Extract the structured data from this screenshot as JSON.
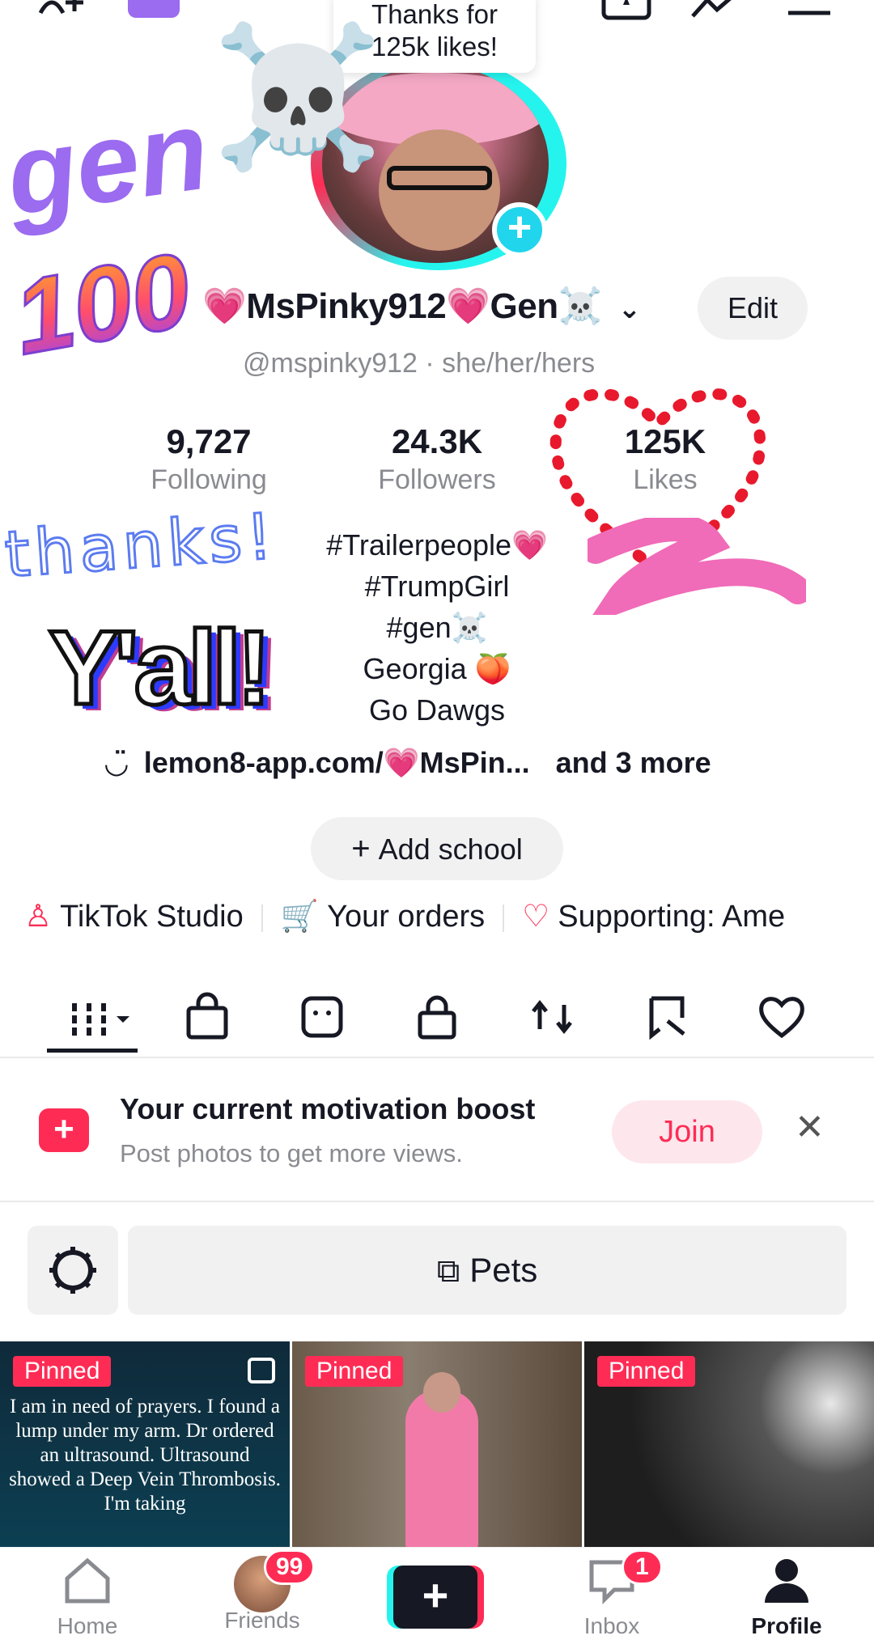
{
  "colors": {
    "accent": "#fe2c55",
    "teal": "#25f4ee",
    "sticker_purple": "#9b6bf0"
  },
  "tooltip": {
    "line1": "Thanks for",
    "line2": "125k likes!"
  },
  "profile": {
    "display_name": "💗MsPinky912💗Gen☠️",
    "edit_label": "Edit",
    "handle": "@mspinky912 · she/her/hers"
  },
  "stats": [
    {
      "value": "9,727",
      "label": "Following"
    },
    {
      "value": "24.3K",
      "label": "Followers"
    },
    {
      "value": "125K",
      "label": "Likes"
    }
  ],
  "bio": [
    "#Trailerpeople💗",
    "#TrumpGirl",
    "#gen☠️",
    "Georgia 🍑",
    "Go Dawgs"
  ],
  "link": {
    "text": "lemon8-app.com/💗MsPin...",
    "more": "and 3 more"
  },
  "add_school": "Add school",
  "tools": [
    {
      "label": "TikTok Studio",
      "icon": "person-star-icon"
    },
    {
      "label": "Your orders",
      "icon": "cart-icon"
    },
    {
      "label": "Supporting: Ame",
      "icon": "heart-hand-icon"
    }
  ],
  "boost": {
    "title": "Your current motivation boost",
    "subtitle": "Post photos to get more views.",
    "join_label": "Join"
  },
  "filter": {
    "label": "Pets"
  },
  "videos": [
    {
      "badge": "Pinned",
      "text": "I am in need of prayers. I found a lump under my arm. Dr ordered an ultrasound. Ultrasound showed a Deep Vein Thrombosis. I'm taking"
    },
    {
      "badge": "Pinned",
      "text": ""
    },
    {
      "badge": "Pinned",
      "text": ""
    }
  ],
  "nav": {
    "home": "Home",
    "friends": "Friends",
    "friends_badge": "99",
    "inbox": "Inbox",
    "inbox_badge": "1",
    "profile": "Profile"
  },
  "stickers": {
    "gen": "gen",
    "hundred": "100",
    "thanks": "thanks!",
    "yall": "Y'all!"
  }
}
